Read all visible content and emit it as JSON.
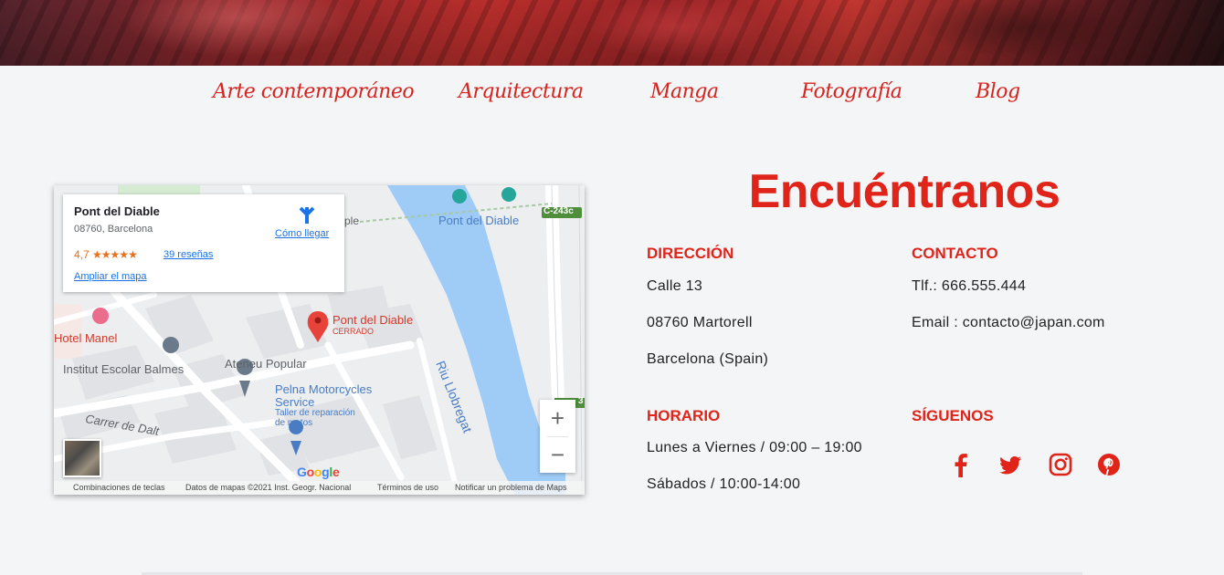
{
  "nav": {
    "items": [
      "Arte contemporáneo",
      "Arquitectura",
      "Manga",
      "Fotografía",
      "Blog"
    ]
  },
  "map": {
    "place_name": "Pont del Diable",
    "address": "08760, Barcelona",
    "rating": "4,7",
    "stars": "★★★★★",
    "reviews": "39 reseñas",
    "enlarge": "Ampliar el mapa",
    "directions": "Cómo llegar",
    "labels": {
      "pont_top": "Pont del Diable",
      "road": "C-243c",
      "river": "Riu Llobregat",
      "pin_name": "Pont del Diable",
      "pin_status": "CERRADO",
      "hotel": "Hotel Manel",
      "school": "Institut Escolar Balmes",
      "ateneu": "Ateneu Popular",
      "pelna1": "Pelna Motorcycles",
      "pelna2": "Service",
      "pelna3": "Taller de reparación",
      "pelna4": "de motos",
      "street": "Carrer de Dalt",
      "partial": "ple",
      "side_num": "3"
    },
    "zoom_in": "+",
    "zoom_out": "−",
    "google": [
      "G",
      "o",
      "o",
      "g",
      "l",
      "e"
    ],
    "attribution": {
      "shortcuts": "Combinaciones de teclas",
      "data": "Datos de mapas ©2021 Inst. Geogr. Nacional",
      "terms": "Términos de uso",
      "report": "Notificar un problema de Maps"
    }
  },
  "contact": {
    "title": "Encuéntranos",
    "address_heading": "DIRECCIÓN",
    "address_lines": [
      "Calle 13",
      "08760 Martorell",
      "Barcelona (Spain)"
    ],
    "contact_heading": "CONTACTO",
    "phone": "Tlf.: 666.555.444",
    "email": "Email : contacto@japan.com",
    "hours_heading": "HORARIO",
    "hours_lines": [
      "Lunes a Viernes / 09:00 – 19:00",
      "Sábados / 10:00-14:00"
    ],
    "follow_heading": "SÍGUENOS"
  },
  "social": [
    "facebook-icon",
    "twitter-icon",
    "instagram-icon",
    "pinterest-icon"
  ],
  "colors": {
    "accent": "#e0241a",
    "river": "#9fcbf7",
    "map_bg": "#eceef0"
  }
}
